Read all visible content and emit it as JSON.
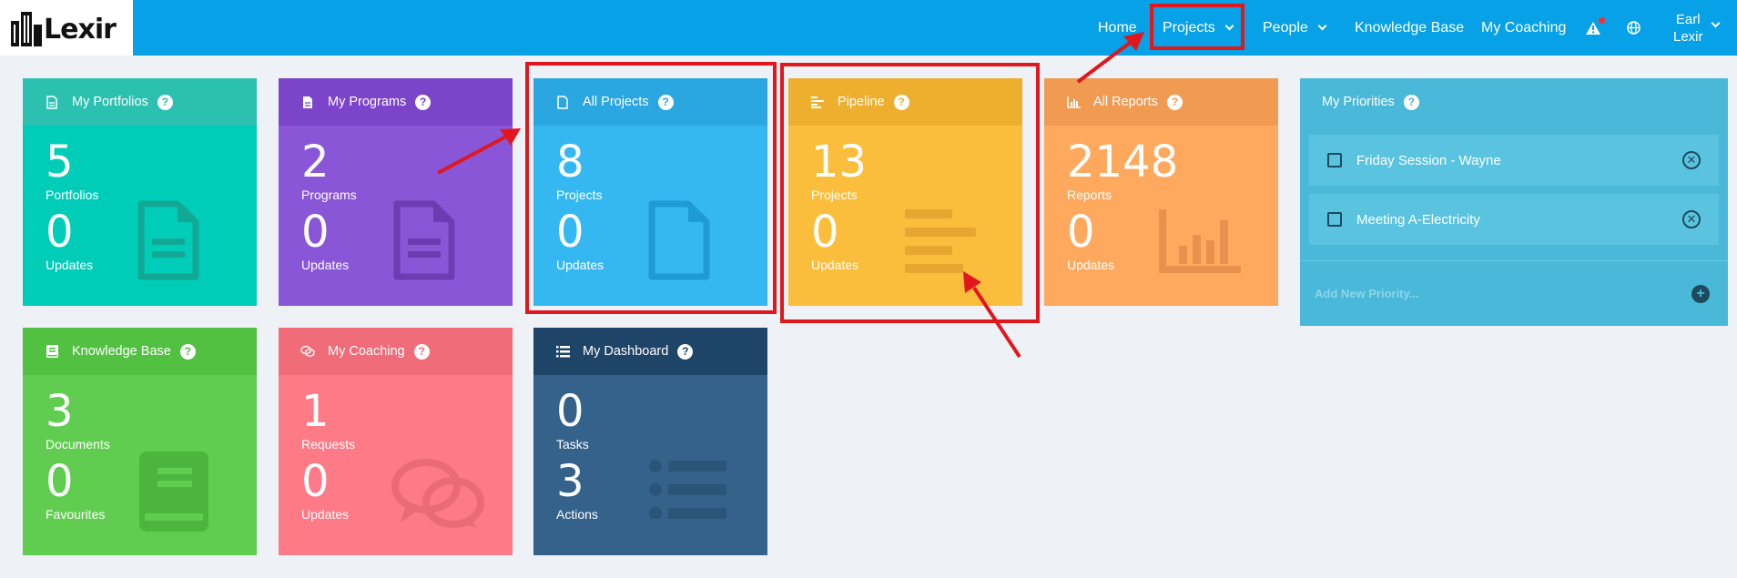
{
  "brand": {
    "logo_text": "Lexir"
  },
  "nav": {
    "home": "Home",
    "projects": "Projects",
    "people": "People",
    "knowledge_base": "Knowledge Base",
    "my_coaching": "My Coaching",
    "user_first": "Earl",
    "user_last": "Lexir"
  },
  "tiles": {
    "portfolios": {
      "title": "My Portfolios",
      "count": "5",
      "count_label": "Portfolios",
      "updates": "0",
      "updates_label": "Updates",
      "color": "#00cdb8",
      "head_color": "#2cc0b0"
    },
    "programs": {
      "title": "My Programs",
      "count": "2",
      "count_label": "Programs",
      "updates": "0",
      "updates_label": "Updates",
      "color": "#8a56d8",
      "head_color": "#7c44c8"
    },
    "all_projects": {
      "title": "All Projects",
      "count": "8",
      "count_label": "Projects",
      "updates": "0",
      "updates_label": "Updates",
      "color": "#35b8f1",
      "head_color": "#2aa6e0"
    },
    "pipeline": {
      "title": "Pipeline",
      "count": "13",
      "count_label": "Projects",
      "updates": "0",
      "updates_label": "Updates",
      "color": "#fbbd3c",
      "head_color": "#eeae2e"
    },
    "all_reports": {
      "title": "All Reports",
      "count": "2148",
      "count_label": "Reports",
      "updates": "0",
      "updates_label": "Updates",
      "color": "#ffa95e",
      "head_color": "#f09a52"
    },
    "knowledge_base": {
      "title": "Knowledge Base",
      "count": "3",
      "count_label": "Documents",
      "updates": "0",
      "updates_label": "Favourites",
      "color": "#60cd50",
      "head_color": "#52c040"
    },
    "my_coaching": {
      "title": "My Coaching",
      "count": "1",
      "count_label": "Requests",
      "updates": "0",
      "updates_label": "Updates",
      "color": "#ff7a87",
      "head_color": "#ef6c78"
    },
    "my_dashboard": {
      "title": "My Dashboard",
      "count": "0",
      "count_label": "Tasks",
      "updates": "3",
      "updates_label": "Actions",
      "color": "#35628a",
      "head_color": "#1e4468"
    }
  },
  "priorities": {
    "title": "My Priorities",
    "items": [
      {
        "label": "Friday Session - Wayne"
      },
      {
        "label": "Meeting A-Electricity"
      }
    ],
    "add_placeholder": "Add New Priority..."
  }
}
